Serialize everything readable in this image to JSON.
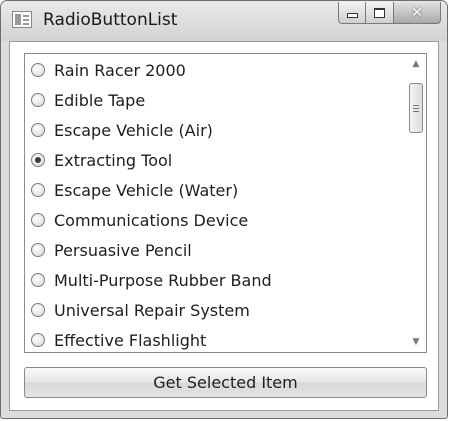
{
  "window": {
    "title": "RadioButtonList",
    "app_icon": "window-app-icon",
    "controls": {
      "minimize_icon": "minimize-icon",
      "maximize_icon": "maximize-icon",
      "close_glyph": "✕"
    }
  },
  "list": {
    "items": [
      {
        "label": "Rain Racer 2000",
        "checked": false
      },
      {
        "label": "Edible Tape",
        "checked": false
      },
      {
        "label": "Escape Vehicle (Air)",
        "checked": false
      },
      {
        "label": "Extracting Tool",
        "checked": true
      },
      {
        "label": "Escape Vehicle (Water)",
        "checked": false
      },
      {
        "label": "Communications Device",
        "checked": false
      },
      {
        "label": "Persuasive Pencil",
        "checked": false
      },
      {
        "label": "Multi-Purpose Rubber Band",
        "checked": false
      },
      {
        "label": "Universal Repair System",
        "checked": false
      },
      {
        "label": "Effective Flashlight",
        "checked": false
      }
    ],
    "selected_label": "Extracting Tool"
  },
  "scrollbar": {
    "up_glyph": "▲",
    "down_glyph": "▼"
  },
  "button": {
    "label": "Get Selected Item"
  }
}
